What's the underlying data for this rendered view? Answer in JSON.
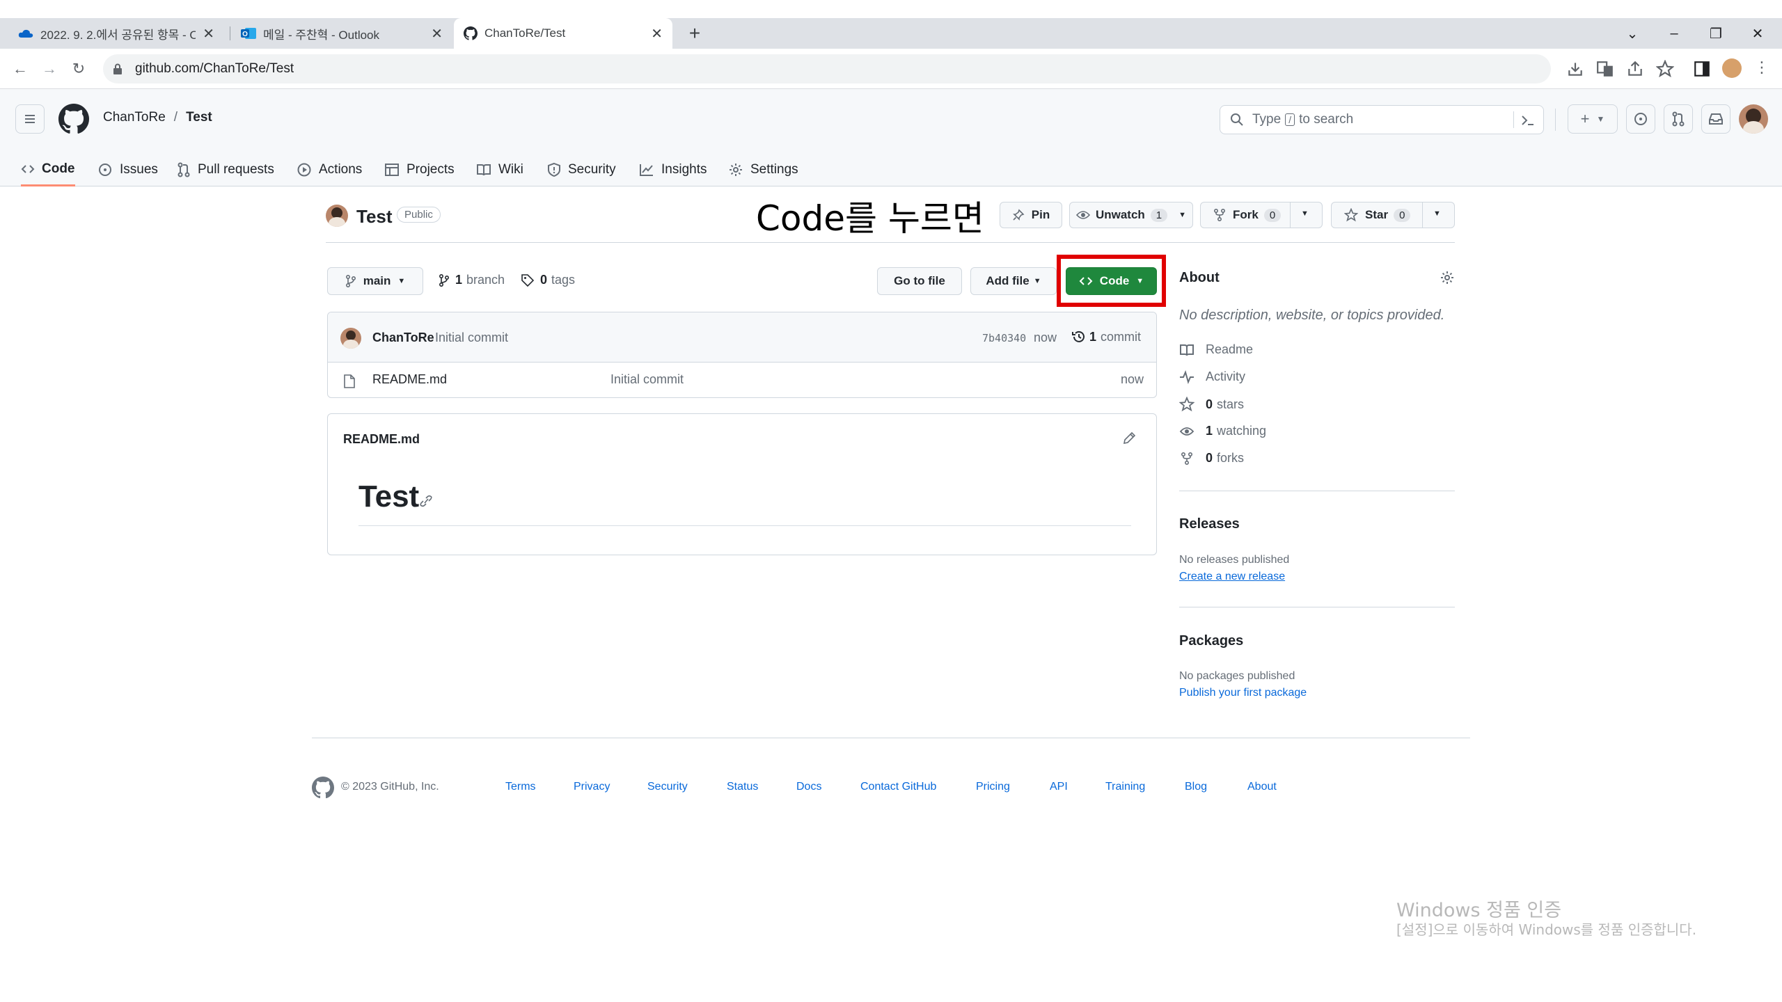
{
  "browser": {
    "tabs": [
      {
        "title": "2022. 9. 2.에서 공유된 항목 - O",
        "icon": "onedrive-icon",
        "active": false
      },
      {
        "title": "메일 - 주찬혁 - Outlook",
        "icon": "outlook-icon",
        "active": false
      },
      {
        "title": "ChanToRe/Test",
        "icon": "github-icon",
        "active": true
      }
    ],
    "url": "github.com/ChanToRe/Test"
  },
  "header": {
    "owner": "ChanToRe",
    "separator": "/",
    "repo": "Test",
    "search_placeholder_pre": "Type",
    "search_key": "/",
    "search_placeholder_post": "to search"
  },
  "repo_nav": [
    {
      "label": "Code",
      "icon": "code-icon",
      "selected": true
    },
    {
      "label": "Issues",
      "icon": "issue-icon"
    },
    {
      "label": "Pull requests",
      "icon": "pull-request-icon"
    },
    {
      "label": "Actions",
      "icon": "play-icon"
    },
    {
      "label": "Projects",
      "icon": "table-icon"
    },
    {
      "label": "Wiki",
      "icon": "book-icon"
    },
    {
      "label": "Security",
      "icon": "shield-icon"
    },
    {
      "label": "Insights",
      "icon": "graph-icon"
    },
    {
      "label": "Settings",
      "icon": "gear-icon"
    }
  ],
  "repo": {
    "name": "Test",
    "visibility": "Public",
    "annotation": "Code를 누르면",
    "pin": "Pin",
    "unwatch": "Unwatch",
    "watch_count": "1",
    "fork": "Fork",
    "fork_count": "0",
    "star": "Star",
    "star_count": "0"
  },
  "file_nav": {
    "branch": "main",
    "branches_count": "1",
    "branches_label": "branch",
    "tags_count": "0",
    "tags_label": "tags",
    "go_to_file": "Go to file",
    "add_file": "Add file",
    "code": "Code"
  },
  "commit": {
    "author": "ChanToRe",
    "message": "Initial commit",
    "sha": "7b40340",
    "time": "now",
    "count": "1",
    "count_label": "commit"
  },
  "files": [
    {
      "name": "README.md",
      "message": "Initial commit",
      "time": "now"
    }
  ],
  "readme": {
    "filename": "README.md",
    "heading": "Test"
  },
  "about": {
    "title": "About",
    "description": "No description, website, or topics provided.",
    "items": [
      {
        "label": "Readme",
        "icon": "book-icon"
      },
      {
        "label": "Activity",
        "icon": "pulse-icon"
      },
      {
        "count": "0",
        "label": "stars",
        "icon": "star-icon"
      },
      {
        "count": "1",
        "label": "watching",
        "icon": "eye-icon"
      },
      {
        "count": "0",
        "label": "forks",
        "icon": "fork-icon"
      }
    ]
  },
  "releases": {
    "title": "Releases",
    "text": "No releases published",
    "link": "Create a new release"
  },
  "packages": {
    "title": "Packages",
    "text": "No packages published",
    "link": "Publish your first package"
  },
  "footer": {
    "copyright": "© 2023 GitHub, Inc.",
    "links": [
      "Terms",
      "Privacy",
      "Security",
      "Status",
      "Docs",
      "Contact GitHub",
      "Pricing",
      "API",
      "Training",
      "Blog",
      "About"
    ]
  },
  "watermark": {
    "line1": "Windows 정품 인증",
    "line2": "[설정]으로 이동하여 Windows를 정품 인증합니다."
  },
  "colors": {
    "accent_green": "#1f883d",
    "highlight_red": "#e00000",
    "link_blue": "#0969da",
    "nav_underline": "#fd8c73"
  }
}
